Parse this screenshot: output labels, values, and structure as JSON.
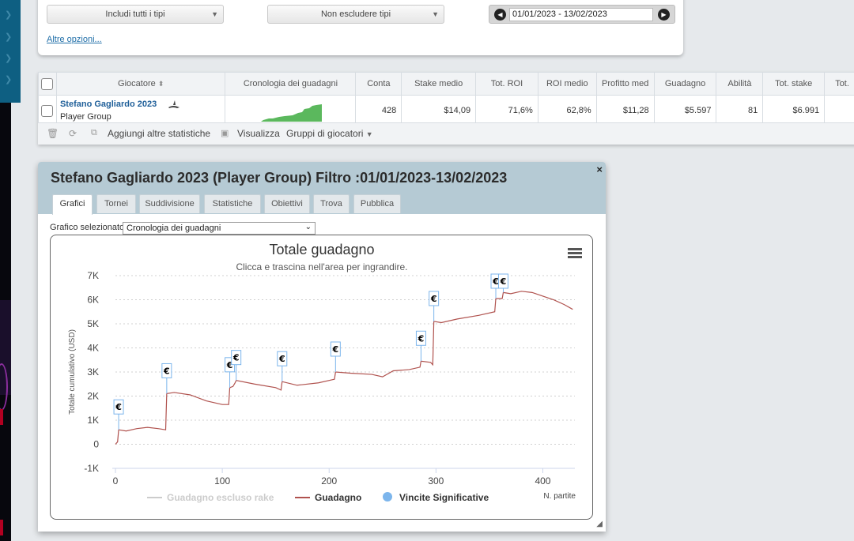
{
  "filters": {
    "include_types": "Includi tutti i tipi",
    "exclude_types": "Non escludere tipi",
    "date_range": "01/01/2023 - 13/02/2023",
    "more_options": "Altre opzioni..."
  },
  "table": {
    "headers": [
      "Giocatore",
      "Cronologia dei guadagni",
      "Conta",
      "Stake medio",
      "Tot. ROI",
      "ROI medio",
      "Profitto med",
      "Guadagno",
      "Abilità",
      "Tot. stake",
      "Tot."
    ],
    "row": {
      "player_name": "Stefano Gagliardo 2023",
      "player_type": "Player Group",
      "conta": "428",
      "stake_medio": "$14,09",
      "tot_roi": "71,6%",
      "roi_medio": "62,8%",
      "profitto_med": "$11,28",
      "guadagno": "$5.597",
      "abilita": "81",
      "tot_stake": "$6.991"
    },
    "toolbar": {
      "add_stats": "Aggiungi altre statistiche",
      "view": "Visualizza",
      "player_groups": "Gruppi di giocatori"
    }
  },
  "dialog": {
    "title": "Stefano Gagliardo 2023 (Player Group) Filtro :01/01/2023-13/02/2023",
    "close": "×",
    "tabs": [
      "Grafici",
      "Tornei",
      "Suddivisione",
      "Statistiche",
      "Obiettivi",
      "Trova",
      "Pubblica"
    ],
    "chart_select_label": "Grafico selezionato",
    "chart_select_value": "Cronologia dei guadagni"
  },
  "chart_data": {
    "type": "line",
    "title": "Totale guadagno",
    "subtitle": "Clicca e trascina nell'area per ingrandire.",
    "ylabel": "Totale cumulativo (USD)",
    "xlabel": "N. partite",
    "xlim": [
      0,
      430
    ],
    "ylim": [
      -1000,
      7000
    ],
    "x_ticks": [
      0,
      100,
      200,
      300,
      400
    ],
    "y_ticks": [
      -1000,
      0,
      1000,
      2000,
      3000,
      4000,
      5000,
      6000,
      7000
    ],
    "y_tick_labels": [
      "-1K",
      "0",
      "1K",
      "2K",
      "3K",
      "4K",
      "5K",
      "6K",
      "7K"
    ],
    "grid": true,
    "legend": [
      "Guadagno escluso rake",
      "Guadagno",
      "Vincite Significative"
    ],
    "legend_position": "bottom",
    "series": [
      {
        "name": "Guadagno",
        "color": "#b0524e",
        "x": [
          0,
          2,
          3,
          10,
          20,
          30,
          40,
          47,
          48,
          55,
          70,
          85,
          100,
          106,
          107,
          110,
          112,
          113,
          130,
          150,
          155,
          156,
          170,
          190,
          205,
          206,
          220,
          240,
          250,
          260,
          275,
          285,
          286,
          295,
          297,
          298,
          305,
          320,
          340,
          355,
          356,
          362,
          363,
          370,
          380,
          390,
          400,
          410,
          420,
          428
        ],
        "y": [
          0,
          100,
          600,
          550,
          650,
          700,
          650,
          600,
          2100,
          2150,
          2050,
          1800,
          1650,
          1650,
          2350,
          2400,
          2550,
          2650,
          2500,
          2350,
          2250,
          2600,
          2450,
          2550,
          2700,
          3000,
          2950,
          2900,
          2800,
          3050,
          3100,
          3200,
          3450,
          3400,
          3300,
          5100,
          5050,
          5200,
          5350,
          5500,
          6050,
          6050,
          6300,
          6250,
          6350,
          6300,
          6150,
          6000,
          5800,
          5600
        ]
      },
      {
        "name": "Guadagno escluso rake",
        "color": "#cccccc",
        "x": [],
        "y": []
      }
    ],
    "significant_wins": {
      "name": "Vincite Significative",
      "color": "#7cb5ec",
      "x": [
        3,
        48,
        107,
        113,
        156,
        206,
        286,
        298,
        356,
        363
      ]
    }
  }
}
